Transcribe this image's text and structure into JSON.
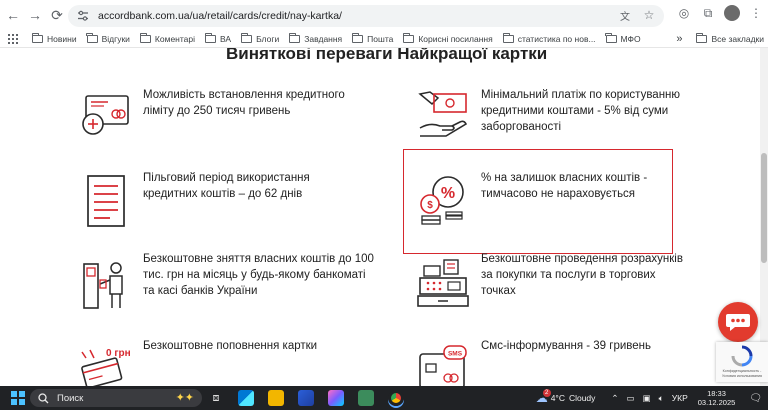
{
  "browser": {
    "url": "accordbank.com.ua/ua/retail/cards/credit/nay-kartka/",
    "bookmarks": [
      "Новини",
      "Відгуки",
      "Коментарі",
      "ВА",
      "Блоги",
      "Завдання",
      "Пошта",
      "Корисні посилання",
      "статистика по нов...",
      "МФО"
    ],
    "all_bookmarks": "Все закладки",
    "more": "»"
  },
  "page": {
    "heading": "Виняткові переваги Найкращої картки",
    "features": [
      {
        "text": "Можливість встановлення кредитного ліміту до 250 тисяч гривень",
        "icon": "credit-card-plus-icon"
      },
      {
        "text": "Мінімальний платіж по користуванню кредитними коштами - 5% від суми заборгованості",
        "icon": "hand-money-icon"
      },
      {
        "text": "Пільговий період використання кредитних коштів – до 62 днів",
        "icon": "document-icon"
      },
      {
        "text": "% на залишок власних коштів - тимчасово не нараховується",
        "icon": "percent-coins-icon"
      },
      {
        "text": "Безкоштовне зняття власних коштів до 100 тис. грн на місяць у будь-якому банкоматі та касі банків України",
        "icon": "atm-withdraw-icon"
      },
      {
        "text": "Безкоштовне проведення розрахунків за покупки та послуги в торгових точках",
        "icon": "cash-register-icon"
      },
      {
        "text": "Безкоштовне поповнення картки",
        "icon": "card-zero-fee-icon"
      },
      {
        "text": "Смс-інформування - 39 гривень",
        "icon": "sms-phone-icon"
      }
    ],
    "zero_fee_label": "0 грн",
    "sms_label": "SMS"
  },
  "recaptcha": {
    "text": "Конфиденциальность - Условия использования"
  },
  "taskbar": {
    "search": "Поиск",
    "weather_temp": "4°C",
    "weather_desc": "Cloudy",
    "weather_badge": "2",
    "lang": "УКР",
    "time": "18:33",
    "date": "03.12.2025"
  },
  "colors": {
    "accent": "#d6282e",
    "icon_dark": "#2b2b2b"
  }
}
